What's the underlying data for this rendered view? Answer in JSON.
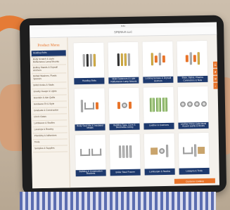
{
  "app": {
    "status_time": "9:41",
    "nav_title": "SPERIUS LLC"
  },
  "sidebar": {
    "title": "Product Menu",
    "items": [
      {
        "label": "Headlug Bolts",
        "active": true
      },
      {
        "label": "Body Scratch & Light Reflectance Lamp Mounts"
      },
      {
        "label": "Bolting Stands & Drywall Anchors"
      },
      {
        "label": "Bolted Washers, Plastic Spacers"
      },
      {
        "label": "Boltd Hooks & Studs"
      },
      {
        "label": "Gravity Gauge & Lights"
      },
      {
        "label": "Guerlain & Alar Quilts"
      },
      {
        "label": "Hardware Fit & Style"
      },
      {
        "label": "Graduate & Construction"
      },
      {
        "label": "Cinch Gates"
      },
      {
        "label": "Lambeaux & Studios"
      },
      {
        "label": "Lassings & Bearing"
      },
      {
        "label": "Plumbing & Adhesives"
      },
      {
        "label": "Tools"
      },
      {
        "label": "Samples & Supplies"
      }
    ]
  },
  "products": [
    {
      "caption": "Headlug Bolts",
      "icon": "bolts"
    },
    {
      "caption": "Slide Fasteners & Light Reflectance Lamp Mounts",
      "icon": "gold-bolts"
    },
    {
      "caption": "Locking Screws & Drywall Anchors",
      "icon": "anchors"
    },
    {
      "caption": "Base, Stylus, Plastics Connectors & Nuts",
      "icon": "plastic-parts"
    },
    {
      "caption": "Body Seal Kits & Insulated Metals",
      "icon": "metals"
    },
    {
      "caption": "Building Tape, Cove & Decorative Lining",
      "icon": "tape"
    },
    {
      "caption": "Leather & Cushions",
      "icon": "tubes"
    },
    {
      "caption": "Leather Prime Light Metal Accent Lights & Rivets",
      "icon": "rivets"
    },
    {
      "caption": "Building & Construction Brackets",
      "icon": "brackets"
    },
    {
      "caption": "Boiler Steel Framer",
      "icon": "steel"
    },
    {
      "caption": "Lamburger & Studios",
      "icon": "parts"
    },
    {
      "caption": "Lasagna & Tools",
      "icon": "tools"
    }
  ],
  "side_tabs": [
    "☰",
    "★",
    "✉",
    "⌕"
  ],
  "bottom_bar": "Customer Catalog"
}
